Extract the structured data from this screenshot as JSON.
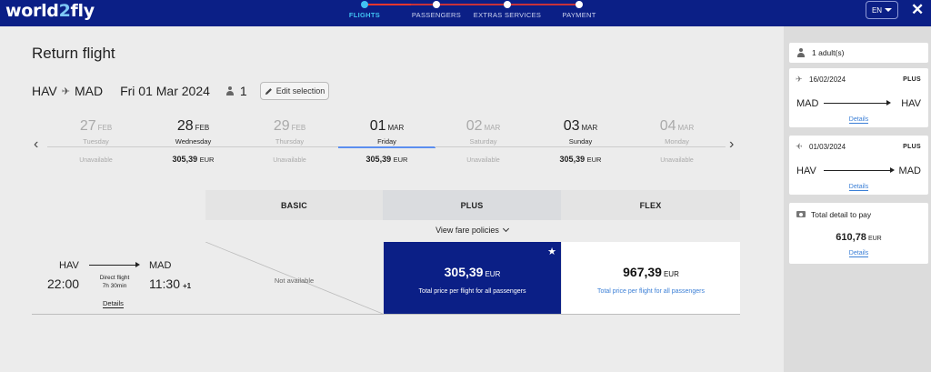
{
  "brand": {
    "logo_left": "world",
    "logo_two": "2",
    "logo_right": "fly"
  },
  "progress": {
    "steps": [
      {
        "label": "FLIGHTS",
        "active": true
      },
      {
        "label": "PASSENGERS",
        "active": false
      },
      {
        "label": "EXTRAS SERVICES",
        "active": false
      },
      {
        "label": "PAYMENT",
        "active": false
      }
    ]
  },
  "header": {
    "language": "EN",
    "close_glyph": "✕"
  },
  "main": {
    "title": "Return flight",
    "route": {
      "from": "HAV",
      "to": "MAD",
      "date": "Fri 01 Mar 2024",
      "passengers": "1"
    },
    "edit_label": "Edit selection"
  },
  "date_nav": {
    "prev_glyph": "‹",
    "next_glyph": "›",
    "days": [
      {
        "day": "27",
        "month": "FEB",
        "weekday": "Tuesday",
        "price": "Unavailable",
        "currency": "",
        "available": false,
        "selected": false
      },
      {
        "day": "28",
        "month": "FEB",
        "weekday": "Wednesday",
        "price": "305,39",
        "currency": "EUR",
        "available": true,
        "selected": false
      },
      {
        "day": "29",
        "month": "FEB",
        "weekday": "Thursday",
        "price": "Unavailable",
        "currency": "",
        "available": false,
        "selected": false
      },
      {
        "day": "01",
        "month": "MAR",
        "weekday": "Friday",
        "price": "305,39",
        "currency": "EUR",
        "available": true,
        "selected": true
      },
      {
        "day": "02",
        "month": "MAR",
        "weekday": "Saturday",
        "price": "Unavailable",
        "currency": "",
        "available": false,
        "selected": false
      },
      {
        "day": "03",
        "month": "MAR",
        "weekday": "Sunday",
        "price": "305,39",
        "currency": "EUR",
        "available": true,
        "selected": false
      },
      {
        "day": "04",
        "month": "MAR",
        "weekday": "Monday",
        "price": "Unavailable",
        "currency": "",
        "available": false,
        "selected": false
      }
    ]
  },
  "fares": {
    "headers": {
      "basic": "BASIC",
      "plus": "PLUS",
      "flex": "FLEX"
    },
    "policies_link": "View fare policies"
  },
  "flight": {
    "from": "HAV",
    "to": "MAD",
    "dep_time": "22:00",
    "arr_time": "11:30",
    "day_offset": "+1",
    "direct_label": "Direct flight",
    "duration": "7h 30min",
    "details_label": "Details",
    "basic_text": "Not available",
    "plus_price": "305,39",
    "plus_currency": "EUR",
    "plus_sub": "Total price per flight for all passengers",
    "flex_price": "967,39",
    "flex_currency": "EUR",
    "flex_sub": "Total price per flight for all passengers"
  },
  "summary": {
    "passengers": "1 adult(s)",
    "outbound": {
      "date": "16/02/2024",
      "fare": "PLUS",
      "from": "MAD",
      "to": "HAV",
      "details": "Details"
    },
    "return": {
      "date": "01/03/2024",
      "fare": "PLUS",
      "from": "HAV",
      "to": "MAD",
      "details": "Details"
    },
    "total": {
      "label": "Total detail to pay",
      "amount": "610,78",
      "currency": "EUR",
      "details": "Details"
    }
  },
  "colors": {
    "brand": "#0b1f86",
    "accent": "#41c2f2",
    "progress": "#e9362d",
    "link": "#3b7fd6",
    "selected_day": "#5b8ef0"
  }
}
